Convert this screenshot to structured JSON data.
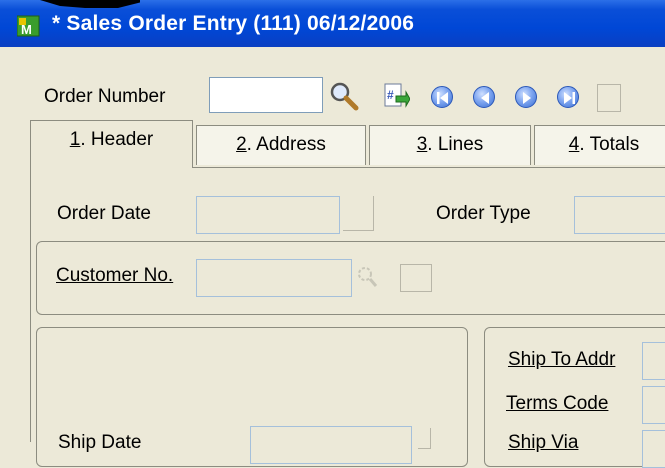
{
  "window": {
    "title": "* Sales Order Entry (111) 06/12/2006"
  },
  "order": {
    "label": "Order Number",
    "value": ""
  },
  "tabs": [
    {
      "label": "1. Header",
      "active": true
    },
    {
      "label": "2. Address",
      "active": false
    },
    {
      "label": "3. Lines",
      "active": false
    },
    {
      "label": "4. Totals",
      "active": false
    }
  ],
  "header": {
    "order_date_label": "Order Date",
    "order_type_label": "Order Type",
    "customer_no_label": "Customer No.",
    "ship_date_label": "Ship Date",
    "ship_to_addr_label": "Ship To Addr",
    "terms_code_label": "Terms Code",
    "ship_via_label": "Ship Via"
  },
  "icons": {
    "app": "mas90-app-icon",
    "lookup": "magnifier-icon",
    "next_number": "next-order-number-icon",
    "first": "first-record-icon",
    "previous": "previous-record-icon",
    "next": "next-record-icon",
    "last": "last-record-icon"
  },
  "colors": {
    "titlebar": "#0047d6",
    "window_bg": "#ece9d8",
    "nav_button": "#3a6fd4"
  }
}
